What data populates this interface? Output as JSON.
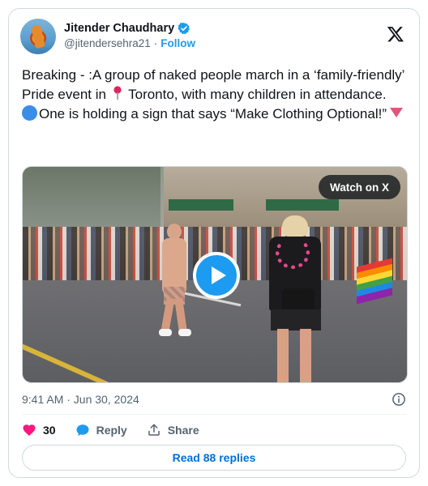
{
  "user": {
    "display_name": "Jitender Chaudhary",
    "handle": "@jitendersehra21",
    "separator": "·",
    "follow_label": "Follow",
    "verified": true
  },
  "tweet": {
    "line1_prefix": "Breaking -  :A group of naked people march in a ‘family-friendly’ Pride event in",
    "line1_suffix": "Toronto, with many children in attendance.",
    "line2": "One is holding a sign that says “Make Clothing Optional!”"
  },
  "media": {
    "watch_label": "Watch on X"
  },
  "meta": {
    "timestamp": "9:41 AM · Jun 30, 2024"
  },
  "actions": {
    "likes": "30",
    "reply_label": "Reply",
    "share_label": "Share"
  },
  "replies_button": "Read 88 replies",
  "colors": {
    "accent": "#1d9bf0",
    "like": "#f91880",
    "text": "#0f1419",
    "secondary": "#536471"
  }
}
